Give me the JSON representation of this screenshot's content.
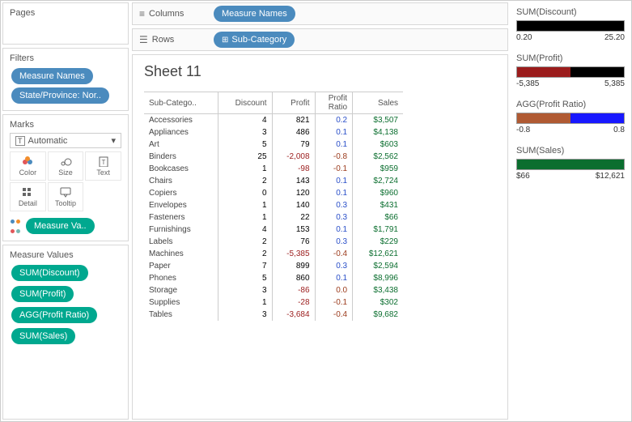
{
  "left": {
    "pages": "Pages",
    "filters": "Filters",
    "filter_pills": [
      "Measure Names",
      "State/Province: Nor.."
    ],
    "marks": "Marks",
    "marks_type": "Automatic",
    "marks_cells": [
      "Color",
      "Size",
      "Text",
      "Detail",
      "Tooltip"
    ],
    "measure_va": "Measure Va..",
    "measure_values": "Measure Values",
    "mv_pills": [
      "SUM(Discount)",
      "SUM(Profit)",
      "AGG(Profit Ratio)",
      "SUM(Sales)"
    ]
  },
  "shelves": {
    "columns": "Columns",
    "rows": "Rows",
    "columns_pill": "Measure Names",
    "rows_pill": "Sub-Category"
  },
  "sheet": {
    "title": "Sheet 11",
    "headers": [
      "Sub-Catego..",
      "Discount",
      "Profit",
      "Profit Ratio",
      "Sales"
    ],
    "rows": [
      {
        "c": "Accessories",
        "d": "4",
        "p": "821",
        "pc": "#000",
        "r": "0.2",
        "rc": "#2a4fc9",
        "s": "$3,507"
      },
      {
        "c": "Appliances",
        "d": "3",
        "p": "486",
        "pc": "#000",
        "r": "0.1",
        "rc": "#2a4fc9",
        "s": "$4,138"
      },
      {
        "c": "Art",
        "d": "5",
        "p": "79",
        "pc": "#000",
        "r": "0.1",
        "rc": "#2a4fc9",
        "s": "$603"
      },
      {
        "c": "Binders",
        "d": "25",
        "p": "-2,008",
        "pc": "#9b1c1c",
        "r": "-0.8",
        "rc": "#9b3b1c",
        "s": "$2,562"
      },
      {
        "c": "Bookcases",
        "d": "1",
        "p": "-98",
        "pc": "#9b1c1c",
        "r": "-0.1",
        "rc": "#9b3b1c",
        "s": "$959"
      },
      {
        "c": "Chairs",
        "d": "2",
        "p": "143",
        "pc": "#000",
        "r": "0.1",
        "rc": "#2a4fc9",
        "s": "$2,724"
      },
      {
        "c": "Copiers",
        "d": "0",
        "p": "120",
        "pc": "#000",
        "r": "0.1",
        "rc": "#2a4fc9",
        "s": "$960"
      },
      {
        "c": "Envelopes",
        "d": "1",
        "p": "140",
        "pc": "#000",
        "r": "0.3",
        "rc": "#2a4fc9",
        "s": "$431"
      },
      {
        "c": "Fasteners",
        "d": "1",
        "p": "22",
        "pc": "#000",
        "r": "0.3",
        "rc": "#2a4fc9",
        "s": "$66"
      },
      {
        "c": "Furnishings",
        "d": "4",
        "p": "153",
        "pc": "#000",
        "r": "0.1",
        "rc": "#2a4fc9",
        "s": "$1,791"
      },
      {
        "c": "Labels",
        "d": "2",
        "p": "76",
        "pc": "#000",
        "r": "0.3",
        "rc": "#2a4fc9",
        "s": "$229"
      },
      {
        "c": "Machines",
        "d": "2",
        "p": "-5,385",
        "pc": "#9b1c1c",
        "r": "-0.4",
        "rc": "#9b3b1c",
        "s": "$12,621"
      },
      {
        "c": "Paper",
        "d": "7",
        "p": "899",
        "pc": "#000",
        "r": "0.3",
        "rc": "#2a4fc9",
        "s": "$2,594"
      },
      {
        "c": "Phones",
        "d": "5",
        "p": "860",
        "pc": "#000",
        "r": "0.1",
        "rc": "#2a4fc9",
        "s": "$8,996"
      },
      {
        "c": "Storage",
        "d": "3",
        "p": "-86",
        "pc": "#9b1c1c",
        "r": "0.0",
        "rc": "#9b3b1c",
        "s": "$3,438"
      },
      {
        "c": "Supplies",
        "d": "1",
        "p": "-28",
        "pc": "#9b1c1c",
        "r": "-0.1",
        "rc": "#9b3b1c",
        "s": "$302"
      },
      {
        "c": "Tables",
        "d": "3",
        "p": "-3,684",
        "pc": "#9b1c1c",
        "r": "-0.4",
        "rc": "#9b3b1c",
        "s": "$9,682"
      }
    ]
  },
  "legends": [
    {
      "title": "SUM(Discount)",
      "min": "0.20",
      "max": "25.20",
      "gradient": "linear-gradient(to right,#000,#000)"
    },
    {
      "title": "SUM(Profit)",
      "min": "-5,385",
      "max": "5,385",
      "gradient": "linear-gradient(to right,#9b1c1c 0%,#9b1c1c 50%,#000 50%,#000 100%)"
    },
    {
      "title": "AGG(Profit Ratio)",
      "min": "-0.8",
      "max": "0.8",
      "gradient": "linear-gradient(to right,#b05a33 0%,#b05a33 50%,#1818ff 50%,#1818ff 100%)"
    },
    {
      "title": "SUM(Sales)",
      "min": "$66",
      "max": "$12,621",
      "gradient": "linear-gradient(to right,#0b6e2f,#0b6e2f)"
    }
  ],
  "chart_data": {
    "type": "table",
    "title": "Sheet 11",
    "columns": [
      "Sub-Category",
      "Discount",
      "Profit",
      "Profit Ratio",
      "Sales"
    ],
    "rows": [
      [
        "Accessories",
        4,
        821,
        0.2,
        3507
      ],
      [
        "Appliances",
        3,
        486,
        0.1,
        4138
      ],
      [
        "Art",
        5,
        79,
        0.1,
        603
      ],
      [
        "Binders",
        25,
        -2008,
        -0.8,
        2562
      ],
      [
        "Bookcases",
        1,
        -98,
        -0.1,
        959
      ],
      [
        "Chairs",
        2,
        143,
        0.1,
        2724
      ],
      [
        "Copiers",
        0,
        120,
        0.1,
        960
      ],
      [
        "Envelopes",
        1,
        140,
        0.3,
        431
      ],
      [
        "Fasteners",
        1,
        22,
        0.3,
        66
      ],
      [
        "Furnishings",
        4,
        153,
        0.1,
        1791
      ],
      [
        "Labels",
        2,
        76,
        0.3,
        229
      ],
      [
        "Machines",
        2,
        -5385,
        -0.4,
        12621
      ],
      [
        "Paper",
        7,
        899,
        0.3,
        2594
      ],
      [
        "Phones",
        5,
        860,
        0.1,
        8996
      ],
      [
        "Storage",
        3,
        -86,
        0.0,
        3438
      ],
      [
        "Supplies",
        1,
        -28,
        -0.1,
        302
      ],
      [
        "Tables",
        3,
        -3684,
        -0.4,
        9682
      ]
    ],
    "color_scales": {
      "Discount": [
        0.2,
        25.2
      ],
      "Profit": [
        -5385,
        5385
      ],
      "Profit Ratio": [
        -0.8,
        0.8
      ],
      "Sales": [
        66,
        12621
      ]
    }
  }
}
